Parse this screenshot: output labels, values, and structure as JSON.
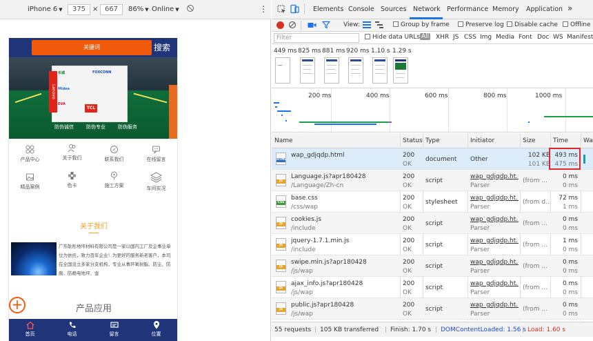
{
  "device_toolbar": {
    "device": "iPhone 6",
    "width": "375",
    "x": "×",
    "height": "667",
    "zoom": "86%",
    "network": "Online",
    "more": "⋮"
  },
  "phone": {
    "search_placeholder": "关键词",
    "search_button": "搜索",
    "banner": {
      "brands": [
        "长城",
        "Midea",
        "FOXCONN",
        "EVA",
        "TCL",
        "Lenovo"
      ],
      "captions": [
        "防伪诚信",
        "防伪专业",
        "防伪服务"
      ]
    },
    "nav": [
      {
        "label": "产品中心",
        "icon": "grid-icon"
      },
      {
        "label": "关于我们",
        "icon": "people-icon"
      },
      {
        "label": "联系我们",
        "icon": "compass-icon"
      },
      {
        "label": "在线留言",
        "icon": "chat-icon"
      },
      {
        "label": "精品案例",
        "icon": "image-icon"
      },
      {
        "label": "色卡",
        "icon": "palette-icon"
      },
      {
        "label": "施工方案",
        "icon": "pin-icon"
      },
      {
        "label": "车间实况",
        "icon": "layers-icon"
      }
    ],
    "about_title": "关于我们",
    "about_text": "广东耿彤地坪材料有限公司是一家以国内工厂及企事业单位为依托，致力百年企业！为更好的服务新老客户，本司在全国设立多家分支机构，专业从事环氧树脂、防尘、防腐、防静电地坪、金",
    "plus": "+",
    "product_title": "产品应用",
    "bottom_nav": [
      {
        "label": "首页",
        "icon": "home-icon"
      },
      {
        "label": "电话",
        "icon": "phone-icon"
      },
      {
        "label": "留言",
        "icon": "message-icon"
      },
      {
        "label": "位置",
        "icon": "location-icon"
      }
    ]
  },
  "devtools": {
    "tabs": [
      "Elements",
      "Console",
      "Sources",
      "Network",
      "Performance",
      "Memory",
      "Application"
    ],
    "active_tab": "Network",
    "more_tabs": "»",
    "toolbar": {
      "view_label": "View:",
      "group_by_frame": "Group by frame",
      "preserve_log": "Preserve log",
      "disable_cache": "Disable cache",
      "offline": "Offline"
    },
    "filter": {
      "placeholder": "Filter",
      "hide_data_urls": "Hide data URLs",
      "types": [
        "All",
        "XHR",
        "JS",
        "CSS",
        "Img",
        "Media",
        "Font",
        "Doc",
        "WS",
        "Manifest"
      ]
    },
    "filmstrip_times": [
      "449 ms",
      "825 ms",
      "881 ms",
      "920 ms",
      "1.10 s",
      "1.29 s"
    ],
    "overview_ticks": [
      "200 ms",
      "400 ms",
      "600 ms",
      "800 ms",
      "1000 ms"
    ],
    "columns": [
      "Name",
      "Status",
      "Type",
      "Initiator",
      "Size",
      "Time",
      "Wat"
    ],
    "rows": [
      {
        "name": "wap_gdjqdp.html",
        "path": "",
        "status": "200",
        "status_text": "OK",
        "type": "document",
        "initiator": "Other",
        "initiator_sub": "",
        "size": "102 KB",
        "size_sub": "101 KB",
        "time": "493 ms",
        "time_sub": "475 ms",
        "icon_tag": "HTML",
        "icon_color": "#2f6fbd"
      },
      {
        "name": "Language.js?apr180428",
        "path": "/Language/Zh-cn",
        "status": "200",
        "status_text": "OK",
        "type": "script",
        "initiator": "wap_gdjqdp.ht...",
        "initiator_sub": "Parser",
        "size": "(from ...",
        "size_sub": "",
        "time": "0 ms",
        "time_sub": "0 ms",
        "icon_tag": "JS",
        "icon_color": "#e8a427"
      },
      {
        "name": "base.css",
        "path": "/css/wap",
        "status": "200",
        "status_text": "OK",
        "type": "stylesheet",
        "initiator": "wap_gdjqdp.ht...",
        "initiator_sub": "Parser",
        "size": "(from d...",
        "size_sub": "",
        "time": "72 ms",
        "time_sub": "1 ms",
        "icon_tag": "CSS",
        "icon_color": "#3d9a3d"
      },
      {
        "name": "cookies.js",
        "path": "/include",
        "status": "200",
        "status_text": "OK",
        "type": "script",
        "initiator": "wap_gdjqdp.ht...",
        "initiator_sub": "Parser",
        "size": "(from ...",
        "size_sub": "",
        "time": "0 ms",
        "time_sub": "0 ms",
        "icon_tag": "JS",
        "icon_color": "#e8a427"
      },
      {
        "name": "jquery-1.7.1.min.js",
        "path": "/include",
        "status": "200",
        "status_text": "OK",
        "type": "script",
        "initiator": "wap_gdjqdp.ht...",
        "initiator_sub": "Parser",
        "size": "(from ...",
        "size_sub": "",
        "time": "1 ms",
        "time_sub": "0 ms",
        "icon_tag": "JS",
        "icon_color": "#e8a427"
      },
      {
        "name": "swipe.min.js?apr180428",
        "path": "/js/wap",
        "status": "200",
        "status_text": "OK",
        "type": "script",
        "initiator": "wap_gdjqdp.ht...",
        "initiator_sub": "Parser",
        "size": "(from ...",
        "size_sub": "",
        "time": "0 ms",
        "time_sub": "0 ms",
        "icon_tag": "JS",
        "icon_color": "#e8a427"
      },
      {
        "name": "ajax_info.js?apr180428",
        "path": "/js/wap",
        "status": "200",
        "status_text": "OK",
        "type": "script",
        "initiator": "wap_gdjqdp.ht...",
        "initiator_sub": "Parser",
        "size": "(from ...",
        "size_sub": "",
        "time": "0 ms",
        "time_sub": "0 ms",
        "icon_tag": "JS",
        "icon_color": "#e8a427"
      },
      {
        "name": "public.js?apr180428",
        "path": "/js/wap",
        "status": "200",
        "status_text": "OK",
        "type": "script",
        "initiator": "wap_gdjqdp.ht...",
        "initiator_sub": "Parser",
        "size": "(from ...",
        "size_sub": "",
        "time": "0 ms",
        "time_sub": "0 ms",
        "icon_tag": "JS",
        "icon_color": "#e8a427"
      }
    ],
    "status_bar": {
      "requests": "55 requests",
      "transferred": "105 KB transferred",
      "finish": "Finish: 1.70 s",
      "dom_loaded": "DOMContentLoaded: 1.56 s",
      "load": "Load: 1.60 s"
    },
    "colors": {
      "accent": "#1a73e8",
      "record": "#d93025",
      "dom_loaded": "#1a47d6",
      "load": "#d93025",
      "highlight": "#e0262a"
    }
  }
}
